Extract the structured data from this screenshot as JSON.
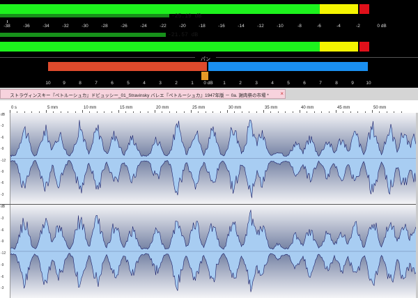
{
  "meters": {
    "channels": [
      {
        "peak_text": "-25.19 dB",
        "level_db": -25.19
      },
      {
        "peak_text": "-21.57 dB",
        "level_db": -21.57
      }
    ],
    "scale_labels": [
      "-38",
      "-36",
      "-34",
      "-32",
      "-30",
      "-28",
      "-26",
      "-24",
      "-22",
      "-20",
      "-18",
      "-16",
      "-14",
      "-12",
      "-10",
      "-8",
      "-6",
      "-4",
      "-2",
      "0 dB"
    ],
    "colors": {
      "green": "#1df21d",
      "yellow": "#f4f400",
      "red": "#e0101a"
    }
  },
  "pan": {
    "title": "パン",
    "labels": [
      "10",
      "9",
      "8",
      "7",
      "6",
      "5",
      "4",
      "3",
      "2",
      "1",
      "0 dB",
      "1",
      "2",
      "3",
      "4",
      "5",
      "6",
      "7",
      "8",
      "9",
      "10"
    ],
    "colors": {
      "left": "#dd4a2c",
      "right": "#1a8ff0",
      "marker": "#e69a26"
    }
  },
  "tab": {
    "title": "ストラヴィンスキー『ペトルーシュカ』ドビュッシー_01_Stravinsky バレエ『ペトルーシュカ』1947年版 － 0a. 謝肉祭の市場 *",
    "close_icon": "close-icon"
  },
  "waveform": {
    "ruler_labels": [
      "0 s",
      "5 mm",
      "10 mm",
      "15 mm",
      "20 mm",
      "25 mm",
      "30 mm",
      "35 mm",
      "40 mm",
      "45 mm",
      "50 mm"
    ],
    "y_labels_top": [
      "dB",
      "-3",
      "-6",
      "-9",
      "-12",
      "-9",
      "-6",
      "-3"
    ],
    "y_labels_bottom": [
      "dB",
      "-3",
      "-6",
      "-9",
      "-12",
      "-9",
      "-6",
      "-3"
    ],
    "wave_color": "#a8cdf2",
    "outline_color": "#1a1f6a"
  }
}
